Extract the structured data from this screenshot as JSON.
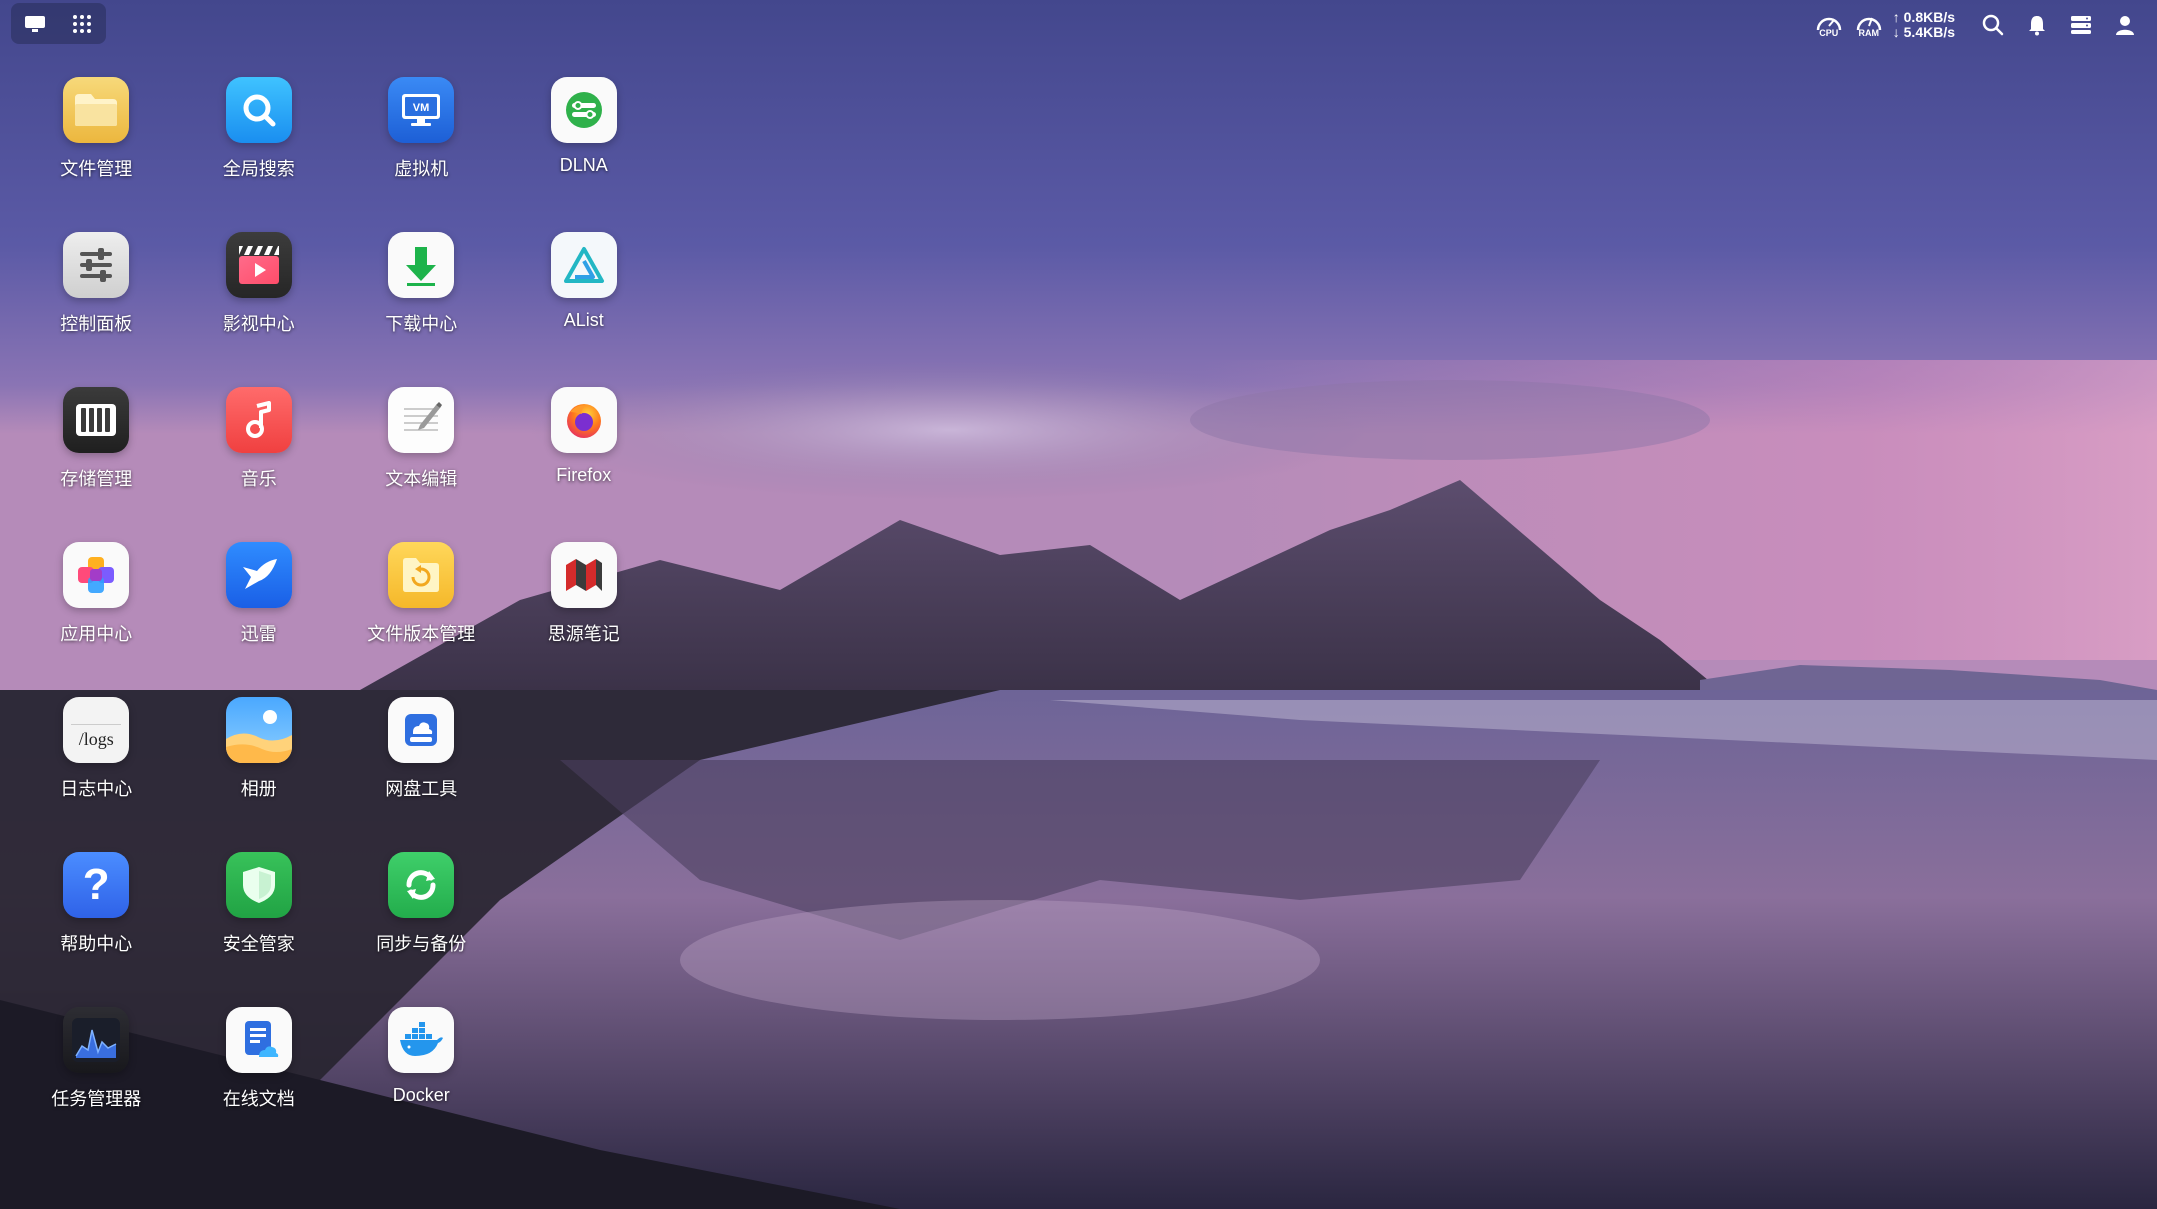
{
  "topbar": {
    "cpu_label": "CPU",
    "ram_label": "RAM",
    "upload_speed": "0.8KB/s",
    "download_speed": "5.4KB/s",
    "icons": [
      "search-icon",
      "bell-icon",
      "server-icon",
      "user-icon"
    ]
  },
  "apps": [
    {
      "label": "文件管理",
      "icon": "folder-icon"
    },
    {
      "label": "全局搜索",
      "icon": "global-search-icon"
    },
    {
      "label": "虚拟机",
      "icon": "vm-icon"
    },
    {
      "label": "DLNA",
      "icon": "dlna-icon"
    },
    {
      "label": "控制面板",
      "icon": "control-panel-icon"
    },
    {
      "label": "影视中心",
      "icon": "video-center-icon"
    },
    {
      "label": "下载中心",
      "icon": "download-icon"
    },
    {
      "label": "AList",
      "icon": "alist-icon"
    },
    {
      "label": "存储管理",
      "icon": "storage-icon"
    },
    {
      "label": "音乐",
      "icon": "music-icon"
    },
    {
      "label": "文本编辑",
      "icon": "text-editor-icon"
    },
    {
      "label": "Firefox",
      "icon": "firefox-icon"
    },
    {
      "label": "应用中心",
      "icon": "app-center-icon"
    },
    {
      "label": "迅雷",
      "icon": "thunder-icon"
    },
    {
      "label": "文件版本管理",
      "icon": "file-version-icon"
    },
    {
      "label": "思源笔记",
      "icon": "siyuan-icon"
    },
    {
      "label": "日志中心",
      "icon": "logs-icon",
      "icon_text": "/logs"
    },
    {
      "label": "相册",
      "icon": "photos-icon"
    },
    {
      "label": "网盘工具",
      "icon": "cloud-drive-icon"
    },
    {
      "label": "帮助中心",
      "icon": "help-icon"
    },
    {
      "label": "安全管家",
      "icon": "security-icon"
    },
    {
      "label": "同步与备份",
      "icon": "sync-icon"
    },
    {
      "label": "任务管理器",
      "icon": "task-manager-icon"
    },
    {
      "label": "在线文档",
      "icon": "online-docs-icon"
    },
    {
      "label": "Docker",
      "icon": "docker-icon"
    }
  ],
  "colors": {
    "sky_top": "#4b4f93",
    "sky_pink": "#c07ab8",
    "sand": "#2a2536",
    "water": "#6a5f8a"
  }
}
